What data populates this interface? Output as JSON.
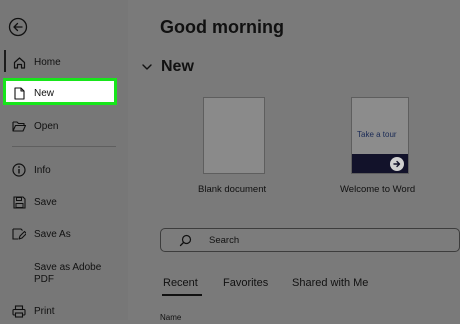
{
  "sidebar": {
    "items": [
      {
        "label": "Home",
        "icon": "home-icon"
      },
      {
        "label": "New",
        "icon": "new-document-icon"
      },
      {
        "label": "Open",
        "icon": "folder-open-icon"
      },
      {
        "label": "Info",
        "icon": "info-icon"
      },
      {
        "label": "Save",
        "icon": "save-icon"
      },
      {
        "label": "Save As",
        "icon": "save-as-icon"
      },
      {
        "label": "Save as Adobe\nPDF",
        "icon": ""
      },
      {
        "label": "Print",
        "icon": "print-icon"
      }
    ],
    "highlight_color": "#17e51a"
  },
  "main": {
    "greeting": "Good morning",
    "new_section": {
      "title": "New",
      "templates": [
        {
          "caption": "Blank document"
        },
        {
          "caption": "Welcome to Word",
          "thumb_text": "Take a tour"
        }
      ]
    },
    "search": {
      "placeholder": "Search"
    },
    "tabs": [
      "Recent",
      "Favorites",
      "Shared with Me"
    ],
    "active_tab": "Recent",
    "list_header": "Name"
  }
}
